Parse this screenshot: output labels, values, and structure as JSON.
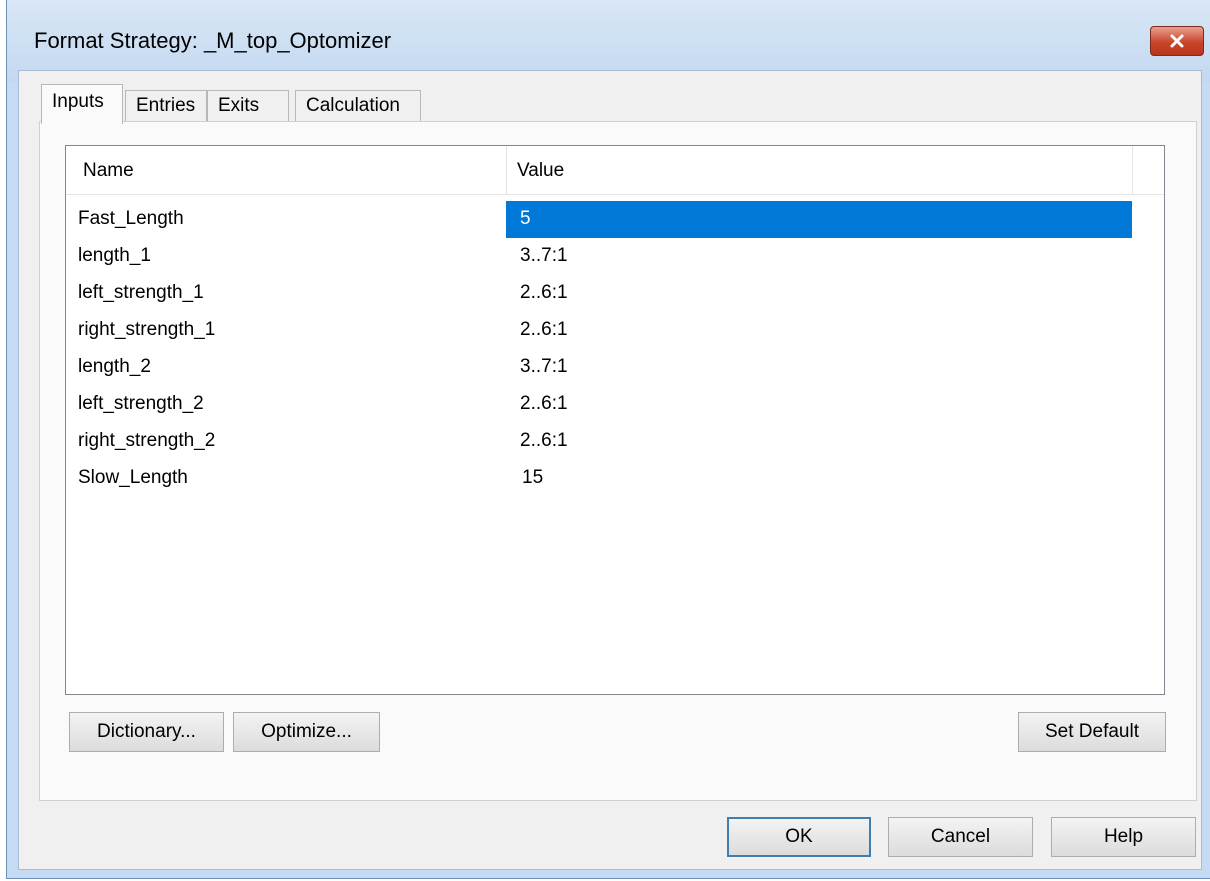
{
  "window": {
    "title": "Format Strategy: _M_top_Optomizer"
  },
  "tabs": [
    {
      "label": "Inputs",
      "active": true
    },
    {
      "label": "Entries",
      "active": false
    },
    {
      "label": "Exits",
      "active": false
    },
    {
      "label": "Calculation",
      "active": false
    }
  ],
  "inputs_list": {
    "columns": [
      "Name",
      "Value"
    ],
    "rows": [
      {
        "name": "Fast_Length",
        "value": "5",
        "selected": true
      },
      {
        "name": "length_1",
        "value": "3..7:1",
        "selected": false
      },
      {
        "name": "left_strength_1",
        "value": "2..6:1",
        "selected": false
      },
      {
        "name": "right_strength_1",
        "value": "2..6:1",
        "selected": false
      },
      {
        "name": "length_2",
        "value": "3..7:1",
        "selected": false
      },
      {
        "name": "left_strength_2",
        "value": "2..6:1",
        "selected": false
      },
      {
        "name": "right_strength_2",
        "value": "2..6:1",
        "selected": false
      },
      {
        "name": "Slow_Length",
        "value": "15",
        "selected": false
      }
    ]
  },
  "panel_buttons": {
    "dictionary": "Dictionary...",
    "optimize": "Optimize...",
    "set_default": "Set Default"
  },
  "dialog_buttons": {
    "ok": "OK",
    "cancel": "Cancel",
    "help": "Help"
  },
  "colors": {
    "selection": "#0078d7",
    "close_button": "#c9452a",
    "title_bar": "#c5dbf3"
  },
  "icons": {
    "close": "close-icon"
  }
}
